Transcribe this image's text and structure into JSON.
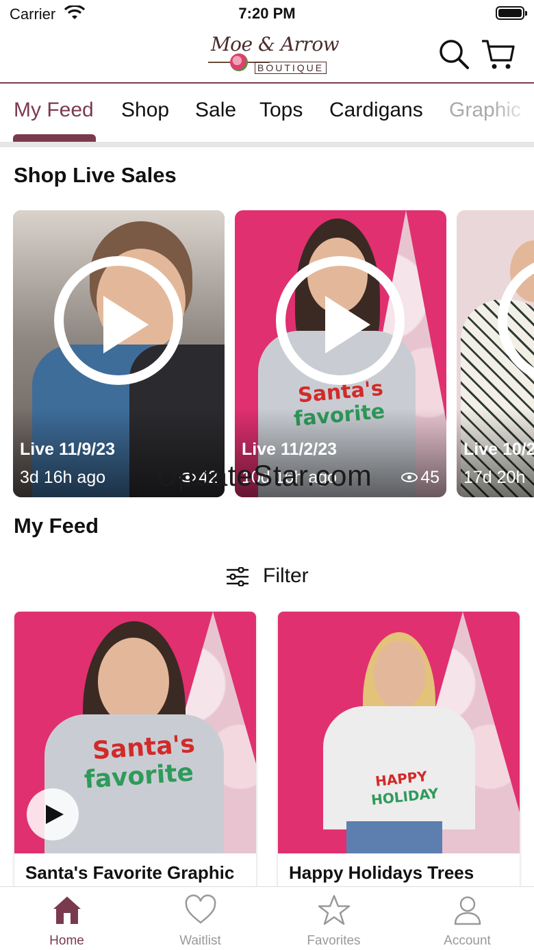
{
  "status_bar": {
    "carrier": "Carrier",
    "time": "7:20 PM"
  },
  "header": {
    "logo_script": "Moe & Arrow",
    "logo_sub": "BOUTIQUE",
    "search_icon": "search-icon",
    "cart_icon": "cart-icon"
  },
  "tabs": [
    {
      "label": "My Feed",
      "active": true
    },
    {
      "label": "Shop"
    },
    {
      "label": "Sale"
    },
    {
      "label": "Tops"
    },
    {
      "label": "Cardigans"
    },
    {
      "label": "Graphic"
    }
  ],
  "live_section": {
    "title": "Shop Live Sales",
    "cards": [
      {
        "date": "Live 11/9/23",
        "ago": "3d 16h ago",
        "views": "42"
      },
      {
        "date": "Live 11/2/23",
        "ago": "10d 16h ago",
        "views": "45"
      },
      {
        "date": "Live 10/2",
        "ago": "17d 20h"
      }
    ]
  },
  "watermark": "UpdateStar.com",
  "feed": {
    "title": "My Feed",
    "filter_label": "Filter",
    "products": [
      {
        "name": "Santa's Favorite Graphic",
        "shirt_text_1": "Santa's",
        "shirt_text_2": "favorite"
      },
      {
        "name": "Happy Holidays Trees",
        "shirt_text_1": "HAPPY",
        "shirt_text_2": "HOLIDAY"
      }
    ]
  },
  "tabbar": [
    {
      "label": "Home",
      "icon": "home-icon",
      "active": true
    },
    {
      "label": "Waitlist",
      "icon": "heart-icon"
    },
    {
      "label": "Favorites",
      "icon": "star-icon"
    },
    {
      "label": "Account",
      "icon": "person-icon"
    }
  ],
  "colors": {
    "brand": "#7a3a4e",
    "backdrop_pink": "#e0306f",
    "divider": "#e6e6e6"
  }
}
